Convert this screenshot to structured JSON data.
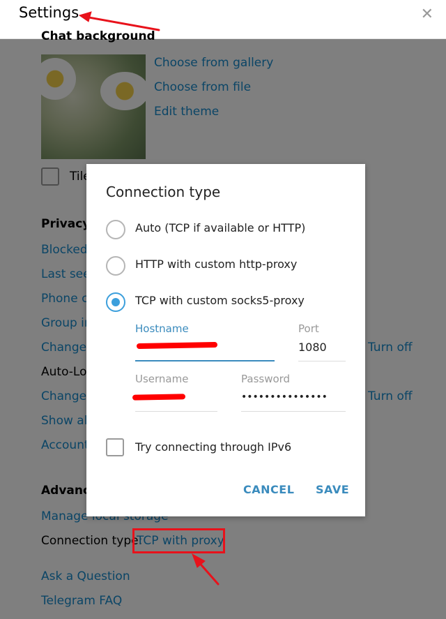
{
  "header": {
    "title": "Settings",
    "close_icon": "close-icon"
  },
  "chat_background": {
    "title": "Chat background",
    "links": [
      "Choose from gallery",
      "Choose from file",
      "Edit theme"
    ],
    "tile_label": "Tile background"
  },
  "privacy": {
    "title": "Privacy and Security",
    "items": [
      "Blocked users",
      "Last seen privacy",
      "Phone calls privacy",
      "Group invite settings",
      "Change local passcode",
      "Auto-Lock",
      "Change cloud password",
      "Show all sessions",
      "Account self-destruct"
    ],
    "turn_off_1": "Turn off",
    "turn_off_2": "Turn off"
  },
  "advanced": {
    "title": "Advanced",
    "manage_storage": "Manage local storage",
    "connection_label": "Connection type:",
    "connection_value": "TCP with proxy",
    "ask_question": "Ask a Question",
    "faq": "Telegram FAQ"
  },
  "dialog": {
    "title": "Connection type",
    "options": [
      {
        "label": "Auto (TCP if available or HTTP)",
        "checked": false
      },
      {
        "label": "HTTP with custom http-proxy",
        "checked": false
      },
      {
        "label": "TCP with custom socks5-proxy",
        "checked": true
      }
    ],
    "hostname_label": "Hostname",
    "port_label": "Port",
    "port_value": "1080",
    "username_label": "Username",
    "password_label": "Password",
    "password_mask": "•••••••••••••••",
    "ipv6_label": "Try connecting through IPv6",
    "cancel": "CANCEL",
    "save": "SAVE"
  },
  "colors": {
    "accent": "#3a8bbd",
    "link": "#168acd",
    "annotation_red": "#e8121b"
  }
}
